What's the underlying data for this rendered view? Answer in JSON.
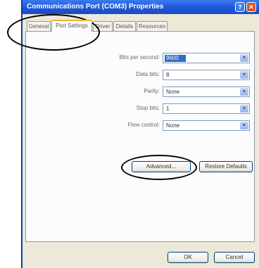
{
  "window": {
    "title": "Communications Port (COM3) Properties",
    "help_glyph": "?",
    "close_glyph": "✕"
  },
  "tabs": [
    {
      "label": "General",
      "active": false
    },
    {
      "label": "Port Settings",
      "active": true
    },
    {
      "label": "Driver",
      "active": false
    },
    {
      "label": "Details",
      "active": false
    },
    {
      "label": "Resources",
      "active": false
    }
  ],
  "settings": [
    {
      "label": "Bits per second:",
      "value": "9600"
    },
    {
      "label": "Data bits:",
      "value": "8"
    },
    {
      "label": "Parity:",
      "value": "None"
    },
    {
      "label": "Stop bits:",
      "value": "1"
    },
    {
      "label": "Flow control:",
      "value": "None"
    }
  ],
  "buttons": {
    "advanced": "Advanced...",
    "restore_defaults": "Restore Defaults",
    "ok": "OK",
    "cancel": "Cancel"
  },
  "dropdown_glyph": "▼"
}
